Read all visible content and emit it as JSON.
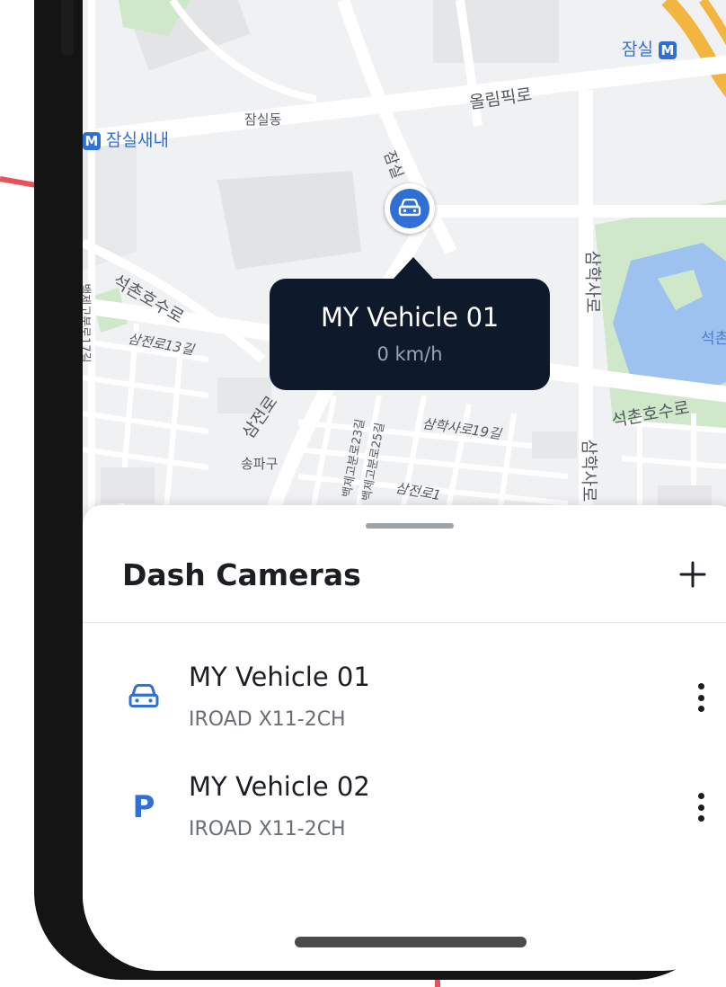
{
  "map": {
    "labels": {
      "jamsil_station": "잠실",
      "jamsil_saenae": "잠실새내",
      "jamsil_dong": "잠실동",
      "olympic_ro": "올림픽로",
      "jamsil_vertical": "잠실",
      "seokchon_ho_su_ro_left": "석촌호수로",
      "samjeon_ro_13": "삼전로13길",
      "left_vertical_road": "백제고분로17길",
      "samhak_sa_ro_upper": "삼학사로",
      "seokchon_lake": "석촌",
      "seokchon_ho_su_ro_right": "석촌호수로",
      "samjeon_ro": "삼전로",
      "samhak_sa_ro_19": "삼학사로19길",
      "baekje_23": "백제고분로23길",
      "baekje_25": "백제고분로25길",
      "songpa_gu": "송파구",
      "samjeon_ro_1": "삼전로1",
      "samhak_sa_ro_lower": "삼학사로",
      "subway_badge": "M"
    },
    "colors": {
      "background": "#f0f1f3",
      "road": "#ffffff",
      "park": "#cfe8c9",
      "water": "#9ec2ef",
      "block": "#e3e4e6",
      "highway": "#f2b640"
    }
  },
  "marker": {
    "icon": "car-icon",
    "color": "#2f6fd6"
  },
  "tooltip": {
    "title": "MY Vehicle 01",
    "speed": "0 km/h"
  },
  "sheet": {
    "title": "Dash Cameras",
    "add_icon": "plus-icon",
    "devices": [
      {
        "name": "MY Vehicle 01",
        "model": "IROAD X11-2CH",
        "status_icon": "car-icon"
      },
      {
        "name": "MY Vehicle 02",
        "model": "IROAD X11-2CH",
        "status_icon": "parking-icon",
        "status_glyph": "P"
      }
    ],
    "more_icon": "more-vertical-icon"
  },
  "theme": {
    "accent": "#2f6fd6",
    "tooltip_bg": "#0e1a2c",
    "decor_red": "#e8505b"
  }
}
